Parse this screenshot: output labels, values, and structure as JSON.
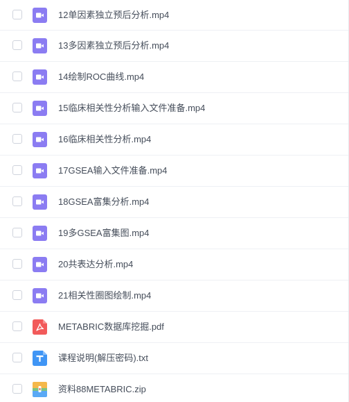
{
  "colors": {
    "video_icon": "#8b7cf2",
    "pdf_icon": "#f25a5a",
    "txt_icon": "#3f95f5",
    "zip_icon_top": "#f5b84a",
    "zip_icon_bottom": "#5aa9f5",
    "text": "#454d5a",
    "divider": "#eef0f4"
  },
  "files": [
    {
      "name": "12单因素独立预后分析.mp4",
      "type": "video",
      "icon": "video-file-icon"
    },
    {
      "name": "13多因素独立预后分析.mp4",
      "type": "video",
      "icon": "video-file-icon"
    },
    {
      "name": "14绘制ROC曲线.mp4",
      "type": "video",
      "icon": "video-file-icon"
    },
    {
      "name": "15临床相关性分析输入文件准备.mp4",
      "type": "video",
      "icon": "video-file-icon"
    },
    {
      "name": "16临床相关性分析.mp4",
      "type": "video",
      "icon": "video-file-icon"
    },
    {
      "name": "17GSEA输入文件准备.mp4",
      "type": "video",
      "icon": "video-file-icon"
    },
    {
      "name": "18GSEA富集分析.mp4",
      "type": "video",
      "icon": "video-file-icon"
    },
    {
      "name": "19多GSEA富集图.mp4",
      "type": "video",
      "icon": "video-file-icon"
    },
    {
      "name": "20共表达分析.mp4",
      "type": "video",
      "icon": "video-file-icon"
    },
    {
      "name": "21相关性圈图绘制.mp4",
      "type": "video",
      "icon": "video-file-icon"
    },
    {
      "name": "METABRIC数据库挖掘.pdf",
      "type": "pdf",
      "icon": "pdf-file-icon"
    },
    {
      "name": "课程说明(解压密码).txt",
      "type": "txt",
      "icon": "text-file-icon"
    },
    {
      "name": "资料88METABRIC.zip",
      "type": "zip",
      "icon": "zip-file-icon"
    }
  ]
}
